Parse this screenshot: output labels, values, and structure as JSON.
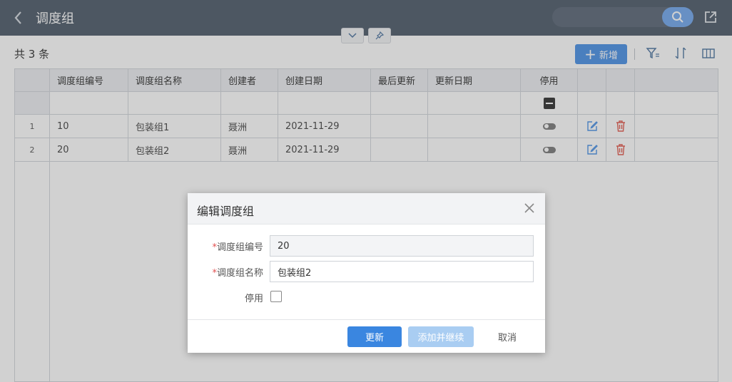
{
  "header": {
    "title": "调度组"
  },
  "list": {
    "count_text": "共 3 条",
    "add_label": "新增"
  },
  "table": {
    "columns": [
      "调度组编号",
      "调度组名称",
      "创建者",
      "创建日期",
      "最后更新",
      "更新日期",
      "停用"
    ],
    "rows": [
      {
        "idx": "1",
        "code": "10",
        "name": "包装组1",
        "creator": "聂洲",
        "created": "2021-11-29",
        "last_update": "",
        "update_date": ""
      },
      {
        "idx": "2",
        "code": "20",
        "name": "包装组2",
        "creator": "聂洲",
        "created": "2021-11-29",
        "last_update": "",
        "update_date": ""
      }
    ]
  },
  "modal": {
    "title": "编辑调度组",
    "fields": {
      "code_label": "调度组编号",
      "code_value": "20",
      "name_label": "调度组名称",
      "name_value": "包装组2",
      "disabled_label": "停用"
    },
    "required_mark": "*",
    "buttons": {
      "update": "更新",
      "add_continue": "添加并继续",
      "cancel": "取消"
    }
  },
  "colors": {
    "header_bg": "#5f6b78",
    "primary": "#3a86e0",
    "danger": "#e56a5e",
    "accent_light": "#5b9be8"
  },
  "icons": [
    "back-icon",
    "search-icon",
    "export-icon",
    "chevron-down-icon",
    "pin-icon",
    "plus-icon",
    "filter-icon",
    "sort-icon",
    "columns-icon",
    "edit-icon",
    "delete-icon",
    "close-icon"
  ]
}
